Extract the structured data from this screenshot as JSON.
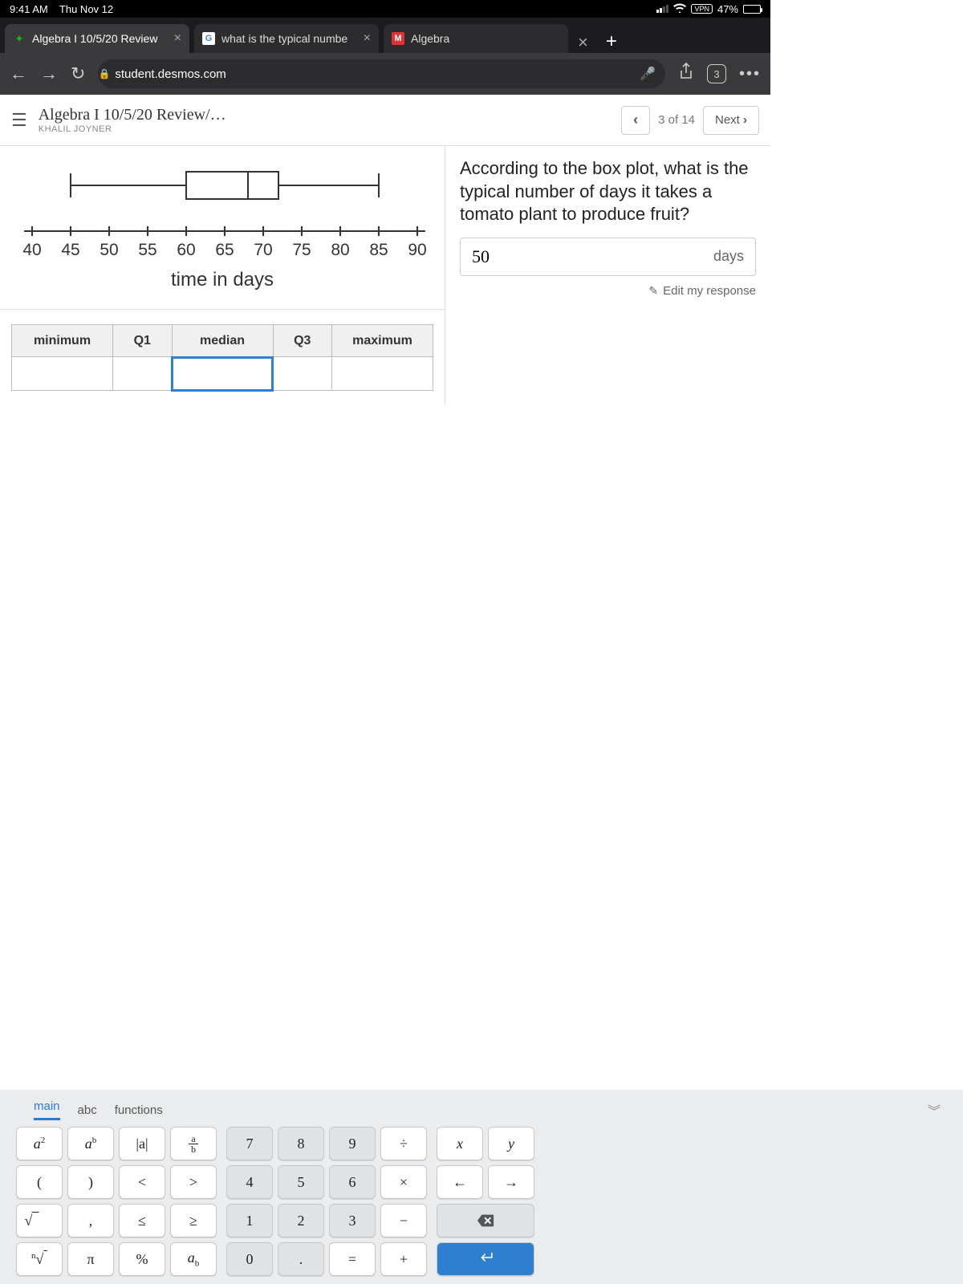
{
  "status": {
    "time": "9:41 AM",
    "date": "Thu Nov 12",
    "vpn": "VPN",
    "battery": "47%"
  },
  "tabs": {
    "t1": "Algebra I 10/5/20 Review",
    "t2": "what is the typical numbe",
    "t3": "Algebra"
  },
  "toolbar": {
    "url": "student.desmos.com",
    "tabcount": "3"
  },
  "pageheader": {
    "title": "Algebra I 10/5/20 Review/…",
    "subtitle": "KHALIL JOYNER",
    "counter": "3 of 14",
    "next": "Next"
  },
  "chart_data": {
    "type": "boxplot",
    "xlabel": "time in days",
    "xlim": [
      40,
      90
    ],
    "ticks": [
      40,
      45,
      50,
      55,
      60,
      65,
      70,
      75,
      80,
      85,
      90
    ],
    "min": 45,
    "q1": 60,
    "median": 68,
    "q3": 72,
    "max": 85
  },
  "ticks": {
    "t0": "40",
    "t1": "45",
    "t2": "50",
    "t3": "55",
    "t4": "60",
    "t5": "65",
    "t6": "70",
    "t7": "75",
    "t8": "80",
    "t9": "85",
    "t10": "90"
  },
  "xlabel": "time in days",
  "question": "According to the box plot, what is the typical number of days it takes a tomato plant to produce fruit?",
  "answer": {
    "value": "50",
    "unit": "days"
  },
  "editresp": "Edit my response",
  "table": {
    "h1": "minimum",
    "h2": "Q1",
    "h3": "median",
    "h4": "Q3",
    "h5": "maximum"
  },
  "kb": {
    "tab_main": "main",
    "tab_abc": "abc",
    "tab_func": "functions",
    "a2": "a",
    "a2s": "2",
    "ab": "a",
    "abs": "b",
    "absv": "|a|",
    "frac_a": "a",
    "frac_b": "b",
    "lp": "(",
    "rp": ")",
    "lt": "<",
    "gt": ">",
    "sqrt": "√",
    "comma": ",",
    "le": "≤",
    "ge": "≥",
    "nroot": "√",
    "pi": "π",
    "pct": "%",
    "asubb": "a",
    "asubb_s": "b",
    "nroot_n": "n",
    "n7": "7",
    "n8": "8",
    "n9": "9",
    "div": "÷",
    "n4": "4",
    "n5": "5",
    "n6": "6",
    "mul": "×",
    "n1": "1",
    "n2": "2",
    "n3": "3",
    "min": "−",
    "n0": "0",
    "dot": ".",
    "eq": "=",
    "plus": "+",
    "x": "x",
    "y": "y",
    "left": "←",
    "right": "→",
    "bks": "⌫",
    "enter": "↵"
  }
}
